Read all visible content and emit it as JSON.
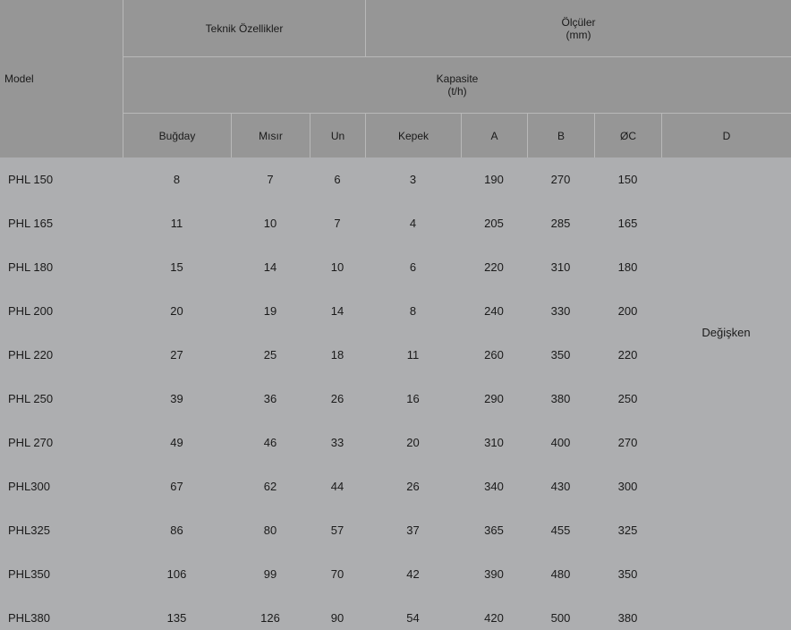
{
  "header": {
    "model": "Model",
    "teknik": "Teknik Özellikler",
    "olculer_line1": "Ölçüler",
    "olculer_line2": "(mm)",
    "kapasite_line1": "Kapasite",
    "kapasite_line2": "(t/h)",
    "columns": [
      "Buğday",
      "Mısır",
      "Un",
      "Kepek",
      "A",
      "B",
      "ØC",
      "D"
    ]
  },
  "d_value": "Değişken",
  "rows": [
    {
      "model": "PHL 150",
      "bugday": "8",
      "misir": "7",
      "un": "6",
      "kepek": "3",
      "a": "190",
      "b": "270",
      "c": "150"
    },
    {
      "model": "PHL 165",
      "bugday": "11",
      "misir": "10",
      "un": "7",
      "kepek": "4",
      "a": "205",
      "b": "285",
      "c": "165"
    },
    {
      "model": "PHL 180",
      "bugday": "15",
      "misir": "14",
      "un": "10",
      "kepek": "6",
      "a": "220",
      "b": "310",
      "c": "180"
    },
    {
      "model": "PHL 200",
      "bugday": "20",
      "misir": "19",
      "un": "14",
      "kepek": "8",
      "a": "240",
      "b": "330",
      "c": "200"
    },
    {
      "model": "PHL 220",
      "bugday": "27",
      "misir": "25",
      "un": "18",
      "kepek": "11",
      "a": "260",
      "b": "350",
      "c": "220"
    },
    {
      "model": "PHL 250",
      "bugday": "39",
      "misir": "36",
      "un": "26",
      "kepek": "16",
      "a": "290",
      "b": "380",
      "c": "250"
    },
    {
      "model": "PHL 270",
      "bugday": "49",
      "misir": "46",
      "un": "33",
      "kepek": "20",
      "a": "310",
      "b": "400",
      "c": "270"
    },
    {
      "model": "PHL300",
      "bugday": "67",
      "misir": "62",
      "un": "44",
      "kepek": "26",
      "a": "340",
      "b": "430",
      "c": "300"
    },
    {
      "model": "PHL325",
      "bugday": "86",
      "misir": "80",
      "un": "57",
      "kepek": "37",
      "a": "365",
      "b": "455",
      "c": "325"
    },
    {
      "model": "PHL350",
      "bugday": "106",
      "misir": "99",
      "un": "70",
      "kepek": "42",
      "a": "390",
      "b": "480",
      "c": "350"
    },
    {
      "model": "PHL380",
      "bugday": "135",
      "misir": "126",
      "un": "90",
      "kepek": "54",
      "a": "420",
      "b": "500",
      "c": "380"
    }
  ]
}
